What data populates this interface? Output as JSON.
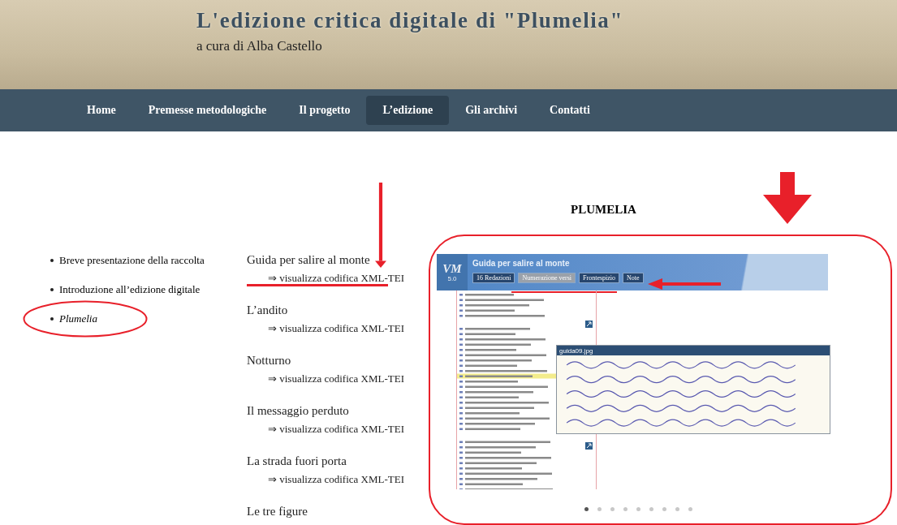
{
  "header": {
    "title": "L'edizione critica digitale di \"Plumelia\"",
    "subtitle": "a cura di Alba Castello"
  },
  "nav": [
    {
      "label": "Home",
      "selected": false
    },
    {
      "label": "Premesse metodologiche",
      "selected": false
    },
    {
      "label": "Il progetto",
      "selected": false
    },
    {
      "label": "L’edizione",
      "selected": true
    },
    {
      "label": "Gli archivi",
      "selected": false
    },
    {
      "label": "Contatti",
      "selected": false
    }
  ],
  "sidebar": {
    "items": [
      {
        "label": "Breve presentazione della raccolta",
        "kind": "link",
        "annotated": false
      },
      {
        "label": "Introduzione all’edizione digitale",
        "kind": "link",
        "annotated": false
      },
      {
        "label": "Plumelia",
        "kind": "title",
        "annotated": true
      }
    ]
  },
  "poems": [
    {
      "title": "Guida per salire al monte",
      "link": "⇒ visualizza codifica XML-TEI",
      "annotated": true
    },
    {
      "title": "L’andito",
      "link": "⇒ visualizza codifica XML-TEI",
      "annotated": false
    },
    {
      "title": "Notturno",
      "link": "⇒ visualizza codifica XML-TEI",
      "annotated": false
    },
    {
      "title": "Il messaggio perduto",
      "link": "⇒ visualizza codifica XML-TEI",
      "annotated": false
    },
    {
      "title": "La strada fuori porta",
      "link": "⇒ visualizza codifica XML-TEI",
      "annotated": false
    },
    {
      "title": "Le tre figure",
      "annotated": false
    }
  ],
  "section_heading": "PLUMELIA",
  "viewer": {
    "logo_text": "VM",
    "logo_version": "5.0",
    "title": "Guida per salire al monte",
    "buttons": [
      {
        "label": "16 Redazioni",
        "selected": false
      },
      {
        "label": "Numerazione versi",
        "selected": true
      },
      {
        "label": "Frontespizio",
        "selected": false
      },
      {
        "label": "Note",
        "selected": false
      }
    ],
    "image_window": {
      "title": "guida09.jpg"
    }
  },
  "carousel": {
    "dots": [
      {
        "selected": true
      },
      {
        "selected": false
      },
      {
        "selected": false
      },
      {
        "selected": false
      },
      {
        "selected": false
      },
      {
        "selected": false
      },
      {
        "selected": false
      },
      {
        "selected": false
      },
      {
        "selected": false
      }
    ]
  }
}
